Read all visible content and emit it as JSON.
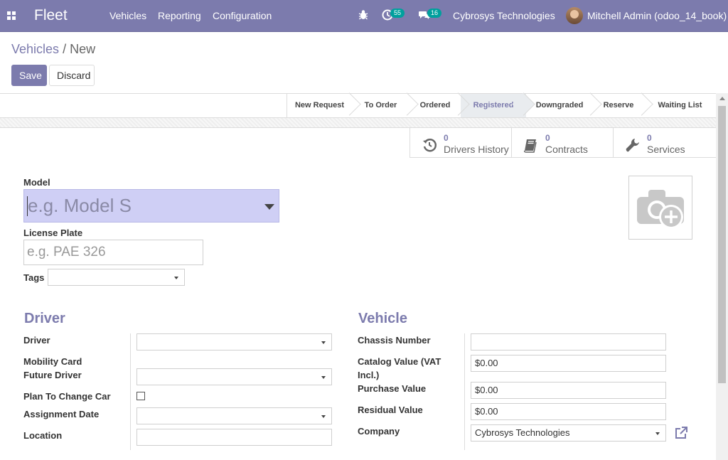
{
  "navbar": {
    "brand": "Fleet",
    "menu": [
      "Vehicles",
      "Reporting",
      "Configuration"
    ],
    "activity_count": "55",
    "message_count": "16",
    "company": "Cybrosys Technologies",
    "user": "Mitchell Admin (odoo_14_book)",
    "colors": {
      "bar": "#7c7bad",
      "badge": "#00a09d"
    }
  },
  "breadcrumb": {
    "parent": "Vehicles",
    "separator": "/",
    "current": "New"
  },
  "buttons": {
    "save": "Save",
    "discard": "Discard"
  },
  "stages": [
    "New Request",
    "To Order",
    "Ordered",
    "Registered",
    "Downgraded",
    "Reserve",
    "Waiting List"
  ],
  "active_stage": "Registered",
  "smart_buttons": [
    {
      "count": "0",
      "label": "Drivers History",
      "icon": "history-icon"
    },
    {
      "count": "0",
      "label": "Contracts",
      "icon": "book-icon"
    },
    {
      "count": "0",
      "label": "Services",
      "icon": "wrench-icon"
    }
  ],
  "form": {
    "model_label": "Model",
    "model_placeholder": "e.g. Model S",
    "plate_label": "License Plate",
    "plate_placeholder": "e.g. PAE 326",
    "tags_label": "Tags"
  },
  "driver_section": {
    "title": "Driver",
    "driver_label": "Driver",
    "mobility_card_label": "Mobility Card",
    "future_driver_label": "Future Driver",
    "plan_change_label": "Plan To Change Car",
    "assignment_date_label": "Assignment Date",
    "location_label": "Location"
  },
  "vehicle_section": {
    "title": "Vehicle",
    "chassis_label": "Chassis Number",
    "catalog_label_1": "Catalog Value (VAT",
    "catalog_label_2": "Incl.)",
    "catalog_value": "$0.00",
    "purchase_label": "Purchase Value",
    "purchase_value": "$0.00",
    "residual_label": "Residual Value",
    "residual_value": "$0.00",
    "company_label": "Company",
    "company_value": "Cybrosys Technologies"
  }
}
